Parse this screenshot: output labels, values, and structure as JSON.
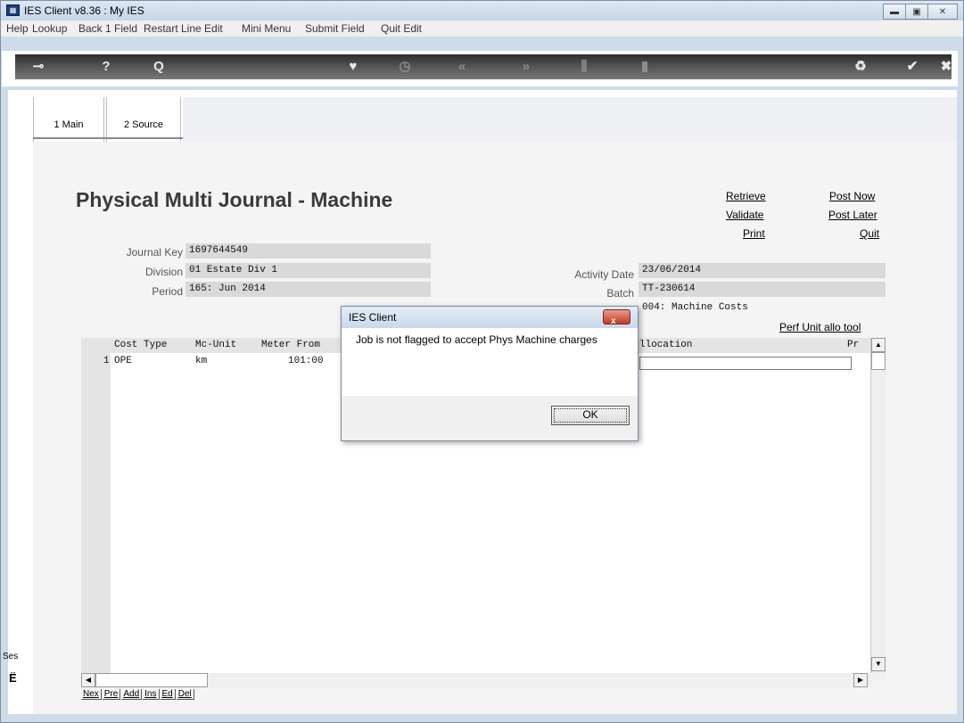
{
  "window": {
    "title": "IES Client v8.36 : My IES",
    "min_icon": "minimize-icon",
    "max_icon": "maximize-icon",
    "close_icon": "close-icon"
  },
  "menu": [
    "Help",
    "Lookup",
    "Back 1 Field",
    "Restart Line Edit",
    "Mini Menu",
    "Submit Field",
    "Quit Edit"
  ],
  "toolbar_icons": [
    "key-icon",
    "help-icon",
    "search-icon",
    "heart-icon",
    "clock-icon",
    "rewind-icon",
    "forward-icon",
    "columns-icon",
    "page-icon",
    "recycle-icon",
    "check-icon",
    "close-icon"
  ],
  "tabs": [
    {
      "label": "1 Main",
      "underline_char": "1",
      "active": true
    },
    {
      "label": "2 Source",
      "underline_char": "2",
      "active": false
    }
  ],
  "page": {
    "title": "Physical Multi Journal - Machine",
    "actions": {
      "retrieve": "Retrieve",
      "validate": "Validate",
      "print": "Print",
      "post_now": "Post Now",
      "post_later": "Post Later",
      "quit": "Quit",
      "perf_unit": "Perf Unit allo tool"
    }
  },
  "fields": {
    "journal_key": {
      "label": "Journal Key",
      "value": "1697644549"
    },
    "division": {
      "label": "Division",
      "value": "01 Estate Div 1"
    },
    "period": {
      "label": "Period",
      "value": "165: Jun 2014"
    },
    "activity_date": {
      "label": "Activity Date",
      "value": "23/06/2014"
    },
    "batch": {
      "label": "Batch",
      "value": "TT-230614"
    },
    "batch_desc": "004: Machine Costs"
  },
  "grid": {
    "headers": {
      "cost_type": "Cost Type",
      "mc_unit": "Mc-Unit",
      "meter_from": "Meter From",
      "allocation": "llocation",
      "pr": "Pr"
    },
    "rows": [
      {
        "num": "1",
        "cost_type": "OPE",
        "mc_unit": "km",
        "meter_from": "101:00"
      }
    ]
  },
  "nav_buttons": [
    "Nex",
    "Pre",
    "Add",
    "Ins",
    "Ed",
    "Del"
  ],
  "session": {
    "label": "Ses",
    "icon": "session-icon"
  },
  "dialog": {
    "title": "IES Client",
    "message": "Job is not flagged to accept Phys Machine charges",
    "ok_label": "OK",
    "close_label": "x"
  }
}
